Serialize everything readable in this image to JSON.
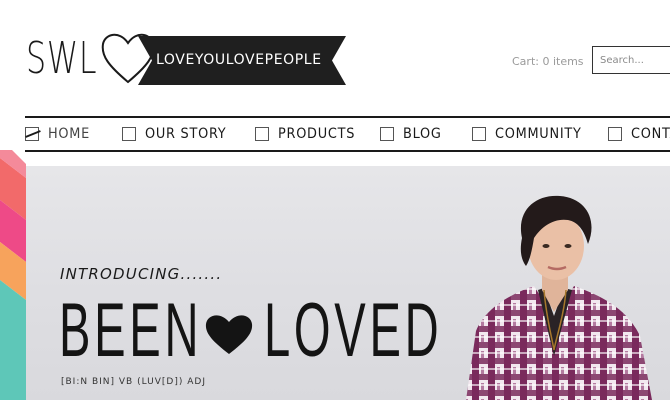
{
  "logo": {
    "letters": "SWL"
  },
  "banner": {
    "text": "LOVEYOULOVEPEOPLE"
  },
  "header": {
    "cart": "Cart: 0 items",
    "search_placeholder": "Search..."
  },
  "nav": {
    "items": [
      {
        "label": "HOME",
        "active": true
      },
      {
        "label": "OUR STORY"
      },
      {
        "label": "PRODUCTS"
      },
      {
        "label": "BLOG"
      },
      {
        "label": "COMMUNITY"
      },
      {
        "label": "CONTACT"
      }
    ]
  },
  "hero": {
    "intro": "INTRODUCING.......",
    "title_word1": "BEEN",
    "title_word2": "LOVED",
    "subtitle": "[BI:N BIN] VB  (LUV[D]) ADJ"
  },
  "colors": {
    "stripe_pink": "#ee4a87",
    "stripe_orange": "#f7a35c",
    "stripe_teal": "#5ec7b8",
    "shirt_purple": "#7a2a5c"
  },
  "icons": [
    "heart-outline-icon",
    "checkbox-icon",
    "heart-filled-icon"
  ]
}
